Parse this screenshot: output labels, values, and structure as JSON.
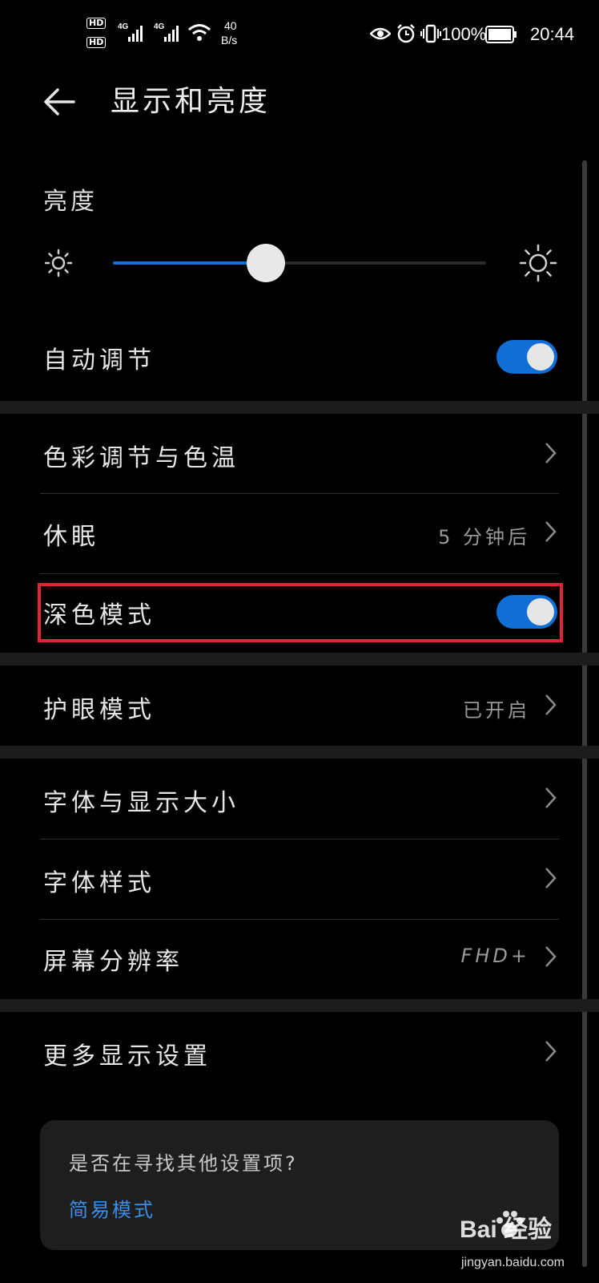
{
  "status_bar": {
    "hd1": "HD",
    "hd2": "HD",
    "net1": "4G",
    "net2": "4G",
    "speed_value": "40",
    "speed_unit": "B/s",
    "battery": "100%",
    "time": "20:44"
  },
  "header": {
    "title": "显示和亮度"
  },
  "brightness": {
    "label": "亮度",
    "level": 0.41
  },
  "rows": {
    "auto_adjust": {
      "label": "自动调节",
      "toggle_on": true
    },
    "color_temp": {
      "label": "色彩调节与色温"
    },
    "sleep": {
      "label": "休眠",
      "value": "5 分钟后"
    },
    "dark_mode": {
      "label": "深色模式",
      "toggle_on": true
    },
    "eye_comfort": {
      "label": "护眼模式",
      "value": "已开启"
    },
    "font_display_size": {
      "label": "字体与显示大小"
    },
    "font_style": {
      "label": "字体样式"
    },
    "resolution": {
      "label": "屏幕分辨率",
      "value": "FHD+"
    },
    "more_display": {
      "label": "更多显示设置"
    }
  },
  "card": {
    "question": "是否在寻找其他设置项?",
    "link": "简易模式"
  },
  "watermark": {
    "brand": "Bai 经验",
    "url": "jingyan.baidu.com"
  },
  "colors": {
    "accent": "#0f6fd6",
    "highlight": "#e0243a",
    "link": "#3d8fe8"
  }
}
